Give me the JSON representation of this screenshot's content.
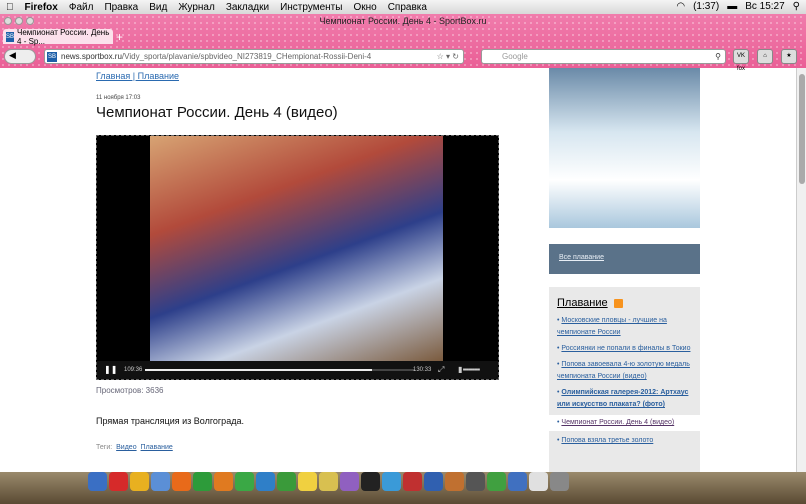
{
  "menubar": {
    "app": "Firefox",
    "items": [
      "Файл",
      "Правка",
      "Вид",
      "Журнал",
      "Закладки",
      "Инструменты",
      "Окно",
      "Справка"
    ],
    "battery": "(1:37)",
    "clock": "Вс 15:27"
  },
  "window": {
    "title": "Чемпионат России. День 4 - SportBox.ru"
  },
  "tab": {
    "label": "Чемпионат России. День 4 - Sp...",
    "favicon": "SB",
    "new_tab": "+"
  },
  "nav": {
    "url_host": "news.sportbox.ru",
    "url_path": "/Vidy_sporta/plavanie/spbvideo_NI273819_CHempionat-Rossii-Deni-4",
    "search_placeholder": "Google",
    "vk_label": "VK fox"
  },
  "article": {
    "breadcrumb": "Главная | Плавание",
    "date": "11 ноября 17:03",
    "title": "Чемпионат России. День 4 (видео)",
    "views": "Просмотров: 3636",
    "lead": "Прямая трансляция из Волгограда.",
    "tags_label": "Теги:",
    "tags": [
      "Видео",
      "Плавание"
    ]
  },
  "player": {
    "current_time": "109:36",
    "total_time": "130:33",
    "progress": 0.84,
    "state": "playing"
  },
  "sidebar": {
    "all_link": "Все плавание",
    "section_title": "Плавание",
    "items": [
      {
        "text": "Московские пловцы - лучшие на чемпионате России"
      },
      {
        "text": "Россиянки не попали в финалы в Токио"
      },
      {
        "text": "Попова завоевала 4-ю золотую медаль чемпионата России (видео)"
      },
      {
        "text": "Олимпийская галерея-2012: Артхаус или искусство плаката? (фото)"
      },
      {
        "text": "Чемпионат России. День 4 (видео)"
      },
      {
        "text": "Попова взяла третье золото"
      }
    ]
  },
  "dock": {
    "colors": [
      "#3a6fc4",
      "#d62a2a",
      "#e8b020",
      "#5b8fd6",
      "#e86a1a",
      "#2d9b3a",
      "#e07a20",
      "#3aa845",
      "#2f7fc8",
      "#3a9a3a",
      "#f0d040",
      "#d8c050",
      "#9060c0",
      "#222222",
      "#3a9ad8",
      "#c03030",
      "#3060b0",
      "#c07030",
      "#555555",
      "#40a040",
      "#4070c0",
      "#e0e0e0",
      "#888888"
    ]
  }
}
